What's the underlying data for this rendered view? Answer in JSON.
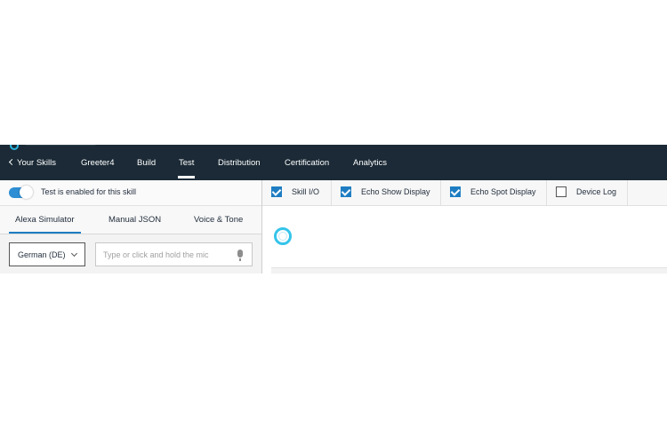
{
  "nav": {
    "back_label": "Your Skills",
    "items": [
      {
        "label": "Greeter4"
      },
      {
        "label": "Build"
      },
      {
        "label": "Test"
      },
      {
        "label": "Distribution"
      },
      {
        "label": "Certification"
      },
      {
        "label": "Analytics"
      }
    ],
    "active": "Test"
  },
  "left_panel": {
    "toggle_label": "Test is enabled for this skill",
    "toggle_on": true,
    "tabs": [
      {
        "label": "Alexa Simulator"
      },
      {
        "label": "Manual JSON"
      },
      {
        "label": "Voice & Tone"
      }
    ],
    "active_tab": "Alexa Simulator",
    "language": "German (DE)",
    "utterance_placeholder": "Type or click and hold the mic"
  },
  "right_panel": {
    "checks": [
      {
        "label": "Skill I/O",
        "checked": true
      },
      {
        "label": "Echo Show Display",
        "checked": true
      },
      {
        "label": "Echo Spot Display",
        "checked": true
      },
      {
        "label": "Device Log",
        "checked": false
      }
    ]
  },
  "colors": {
    "nav_bg": "#1b2a36",
    "accent": "#1e7dc2",
    "alexa": "#35c4ea"
  }
}
